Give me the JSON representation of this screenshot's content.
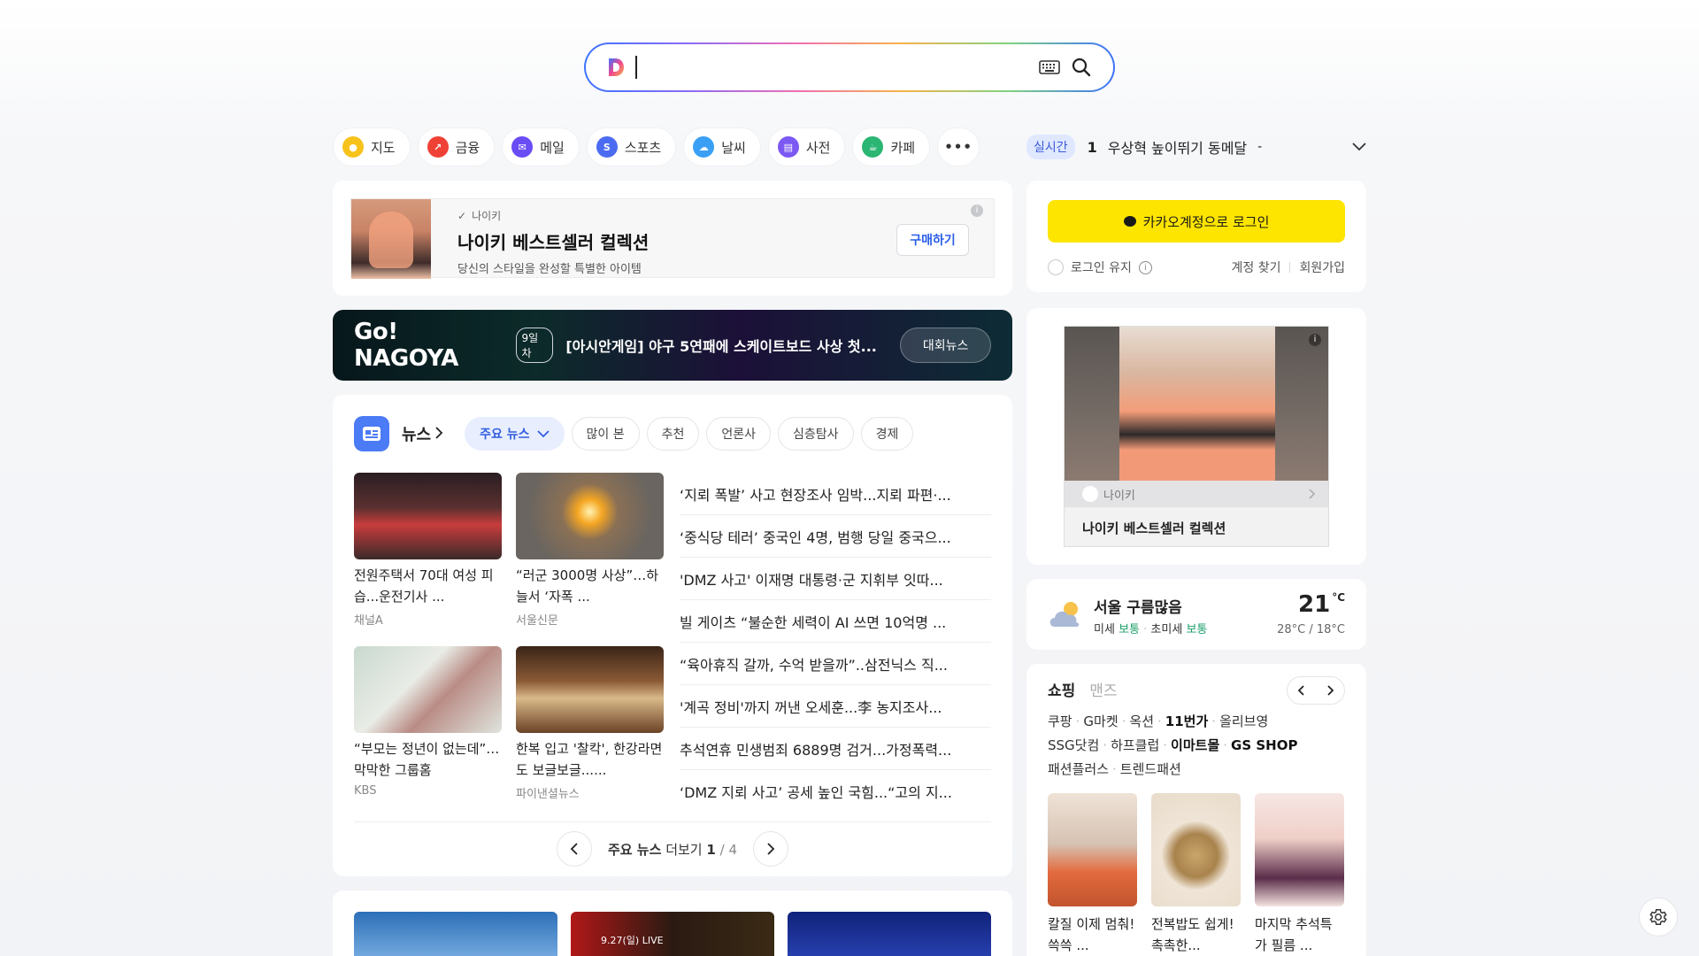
{
  "search": {
    "placeholder": ""
  },
  "services": [
    {
      "label": "지도",
      "icon": "map-pin-icon",
      "color": "#f7c21b"
    },
    {
      "label": "금융",
      "icon": "finance-icon",
      "color": "#ef4136"
    },
    {
      "label": "메일",
      "icon": "mail-icon",
      "color": "#6a4cf5"
    },
    {
      "label": "스포츠",
      "icon": "sports-icon",
      "color": "#4b6cf0"
    },
    {
      "label": "날씨",
      "icon": "weather-icon",
      "color": "#3aa0f5"
    },
    {
      "label": "사전",
      "icon": "dictionary-icon",
      "color": "#7b59f2"
    },
    {
      "label": "카페",
      "icon": "cafe-icon",
      "color": "#2bb673"
    }
  ],
  "realtime": {
    "badge": "실시간",
    "rank": "1",
    "keyword": "우상혁 높이뛰기 동메달",
    "change": "-"
  },
  "ad_top": {
    "brand": "나이키",
    "title": "나이키 베스트셀러 컬렉션",
    "desc": "당신의 스타일을 완성할 특별한 아이템",
    "button": "구매하기"
  },
  "banner": {
    "logo": "Go! NAGOYA",
    "day": "9일차",
    "text": "[아시안게임] 야구 5연패에 스케이트보드 사상 첫...",
    "button": "대회뉴스"
  },
  "news": {
    "title": "뉴스",
    "tabs": [
      "주요 뉴스",
      "많이 본",
      "추천",
      "언론사",
      "심층탐사",
      "경제"
    ],
    "thumbs": [
      {
        "title": "전원주택서 70대 여성 피습...운전기사 ...",
        "source": "채널A"
      },
      {
        "title": "“러군 3000명 사상”…하늘서 ‘자폭 ...",
        "source": "서울신문"
      },
      {
        "title": "“부모는 정년이 없는데”…막막한 그룹홈",
        "source": "KBS"
      },
      {
        "title": "한복 입고 '찰칵', 한강라면도 보글보글......",
        "source": "파이낸셜뉴스"
      }
    ],
    "headlines": [
      "‘지뢰 폭발’ 사고 현장조사 임박...지뢰 파편·...",
      "‘중식당 테러’ 중국인 4명, 범행 당일 중국으...",
      "'DMZ 사고' 이재명 대통령·군 지휘부 잇따...",
      "빌 게이츠 “불순한 세력이 AI 쓰면 10억명 ...",
      "“육아휴직 갈까, 수억 받을까”..삼전닉스 직...",
      "'계곡 정비'까지 꺼낸 오세훈...李 농지조사...",
      "추석연휴 민생범죄 6889명 검거...가정폭력...",
      "‘DMZ 지뢰 사고’ 공세 높인 국힘...“고의 지..."
    ],
    "pager": {
      "label": "주요 뉴스",
      "more": "더보기",
      "page": "1",
      "sep": "/",
      "total": "4"
    }
  },
  "video": {
    "badge": "9.27(일) LIVE"
  },
  "login": {
    "kakao_button": "카카오계정으로 로그인",
    "keep": "로그인 유지",
    "find": "계정 찾기",
    "join": "회원가입"
  },
  "ad_side": {
    "brand": "나이키",
    "title": "나이키 베스트셀러 컬렉션"
  },
  "weather": {
    "city": "서울 구름많음",
    "dust_label": "미세",
    "dust_value": "보통",
    "fine_label": "초미세",
    "fine_value": "보통",
    "temp": "21",
    "unit": "°C",
    "range": "28°C / 18°C"
  },
  "shopping": {
    "tab_active": "쇼핑",
    "tab_other": "맨즈",
    "links": [
      {
        "label": "쿠팡",
        "bold": false
      },
      {
        "label": "G마켓",
        "bold": false
      },
      {
        "label": "옥션",
        "bold": false
      },
      {
        "label": "11번가",
        "bold": true
      },
      {
        "label": "올리브영",
        "bold": false
      },
      {
        "label": "SSG닷컴",
        "bold": false
      },
      {
        "label": "하프클럽",
        "bold": false
      },
      {
        "label": "이마트몰",
        "bold": false
      },
      {
        "label": "GS SHOP",
        "bold": true
      },
      {
        "label": "패션플러스",
        "bold": false
      },
      {
        "label": "트렌드패션",
        "bold": false
      }
    ],
    "products": [
      {
        "title": "칼질 이제 멈춰! 쓱쓱 ..."
      },
      {
        "title": "전복밥도 쉽게! 촉촉한..."
      },
      {
        "title": "마지막 추석특가 필름 ..."
      }
    ]
  }
}
